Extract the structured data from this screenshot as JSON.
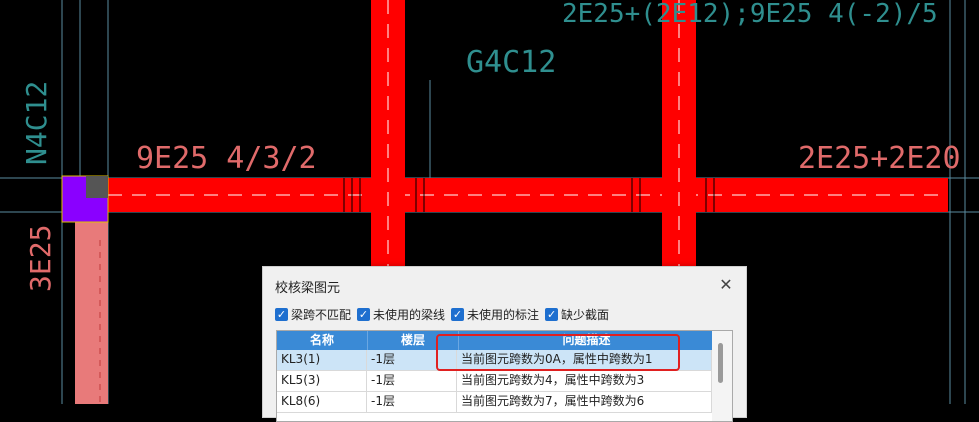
{
  "cad": {
    "labels": {
      "top_right": "2E25+(2E12);9E25 4(-2)/5",
      "mid_top": "G4C12",
      "left_vertical": "N4C12",
      "beam_left": "9E25 4/3/2",
      "beam_right": "2E25+2E20",
      "bottom_left_vertical": "3E25"
    },
    "colors": {
      "beam": "#ff0000",
      "column": "#8a00ff",
      "grid": "#5a8ca0",
      "label_pink": "#e06a6a",
      "label_cyan": "#2f8f8f"
    }
  },
  "dialog": {
    "title": "校核梁图元",
    "close_icon": "close-icon",
    "filters": [
      {
        "label": "梁跨不匹配",
        "checked": true
      },
      {
        "label": "未使用的梁线",
        "checked": true
      },
      {
        "label": "未使用的标注",
        "checked": true
      },
      {
        "label": "缺少截面",
        "checked": true
      }
    ],
    "table": {
      "headers": [
        "名称",
        "楼层",
        "问题描述"
      ],
      "rows": [
        [
          "KL3(1)",
          "-1层",
          "当前图元跨数为0A，属性中跨数为1"
        ],
        [
          "KL5(3)",
          "-1层",
          "当前图元跨数为4，属性中跨数为3"
        ],
        [
          "KL8(6)",
          "-1层",
          "当前图元跨数为7，属性中跨数为6"
        ]
      ]
    }
  }
}
